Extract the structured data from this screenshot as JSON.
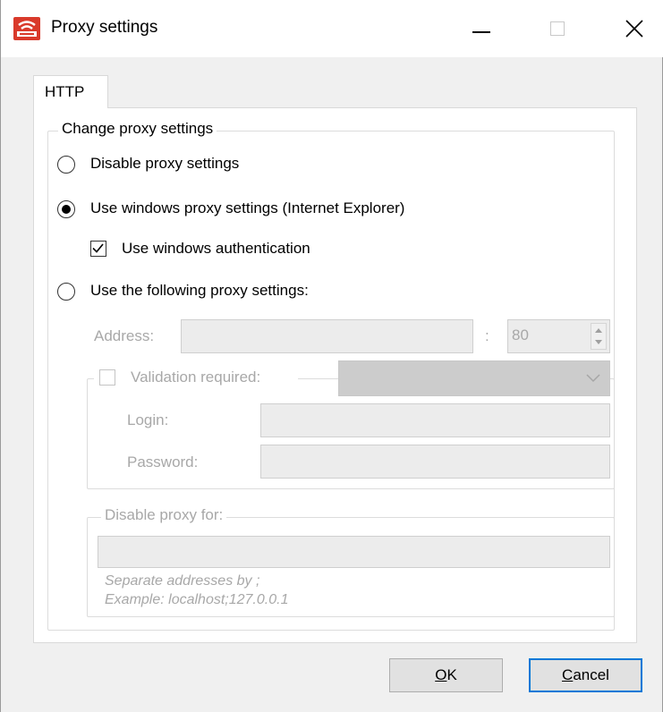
{
  "window": {
    "title": "Proxy settings",
    "controls": [
      "minimize-icon",
      "maximize-icon",
      "close-icon"
    ]
  },
  "tabs": [
    {
      "label": "HTTP",
      "selected": true
    }
  ],
  "change_group": {
    "legend": "Change proxy settings",
    "options": {
      "disable": {
        "label": "Disable proxy settings",
        "checked": false
      },
      "windows": {
        "label": "Use windows proxy settings (Internet Explorer)",
        "checked": true
      },
      "windows_auth": {
        "label": "Use windows authentication",
        "checked": true
      },
      "following": {
        "label": "Use the following proxy settings:",
        "checked": false
      }
    }
  },
  "proxy": {
    "address_label": "Address:",
    "address_value": "",
    "port_sep": ":",
    "port_value": "80",
    "validation": {
      "label": "Validation required:",
      "checked": false,
      "selected": ""
    },
    "login_label": "Login:",
    "login_value": "",
    "password_label": "Password:",
    "password_value": ""
  },
  "bypass": {
    "legend": "Disable proxy for:",
    "value": "",
    "hint1": "Separate addresses by ;",
    "hint2": "Example: localhost;127.0.0.1"
  },
  "buttons": {
    "ok_mnemonic": "O",
    "ok_rest": "K",
    "cancel_mnemonic": "C",
    "cancel_rest": "ancel"
  },
  "colors": {
    "accent": "#0078d7",
    "disabled_text": "#a8a8a8"
  }
}
